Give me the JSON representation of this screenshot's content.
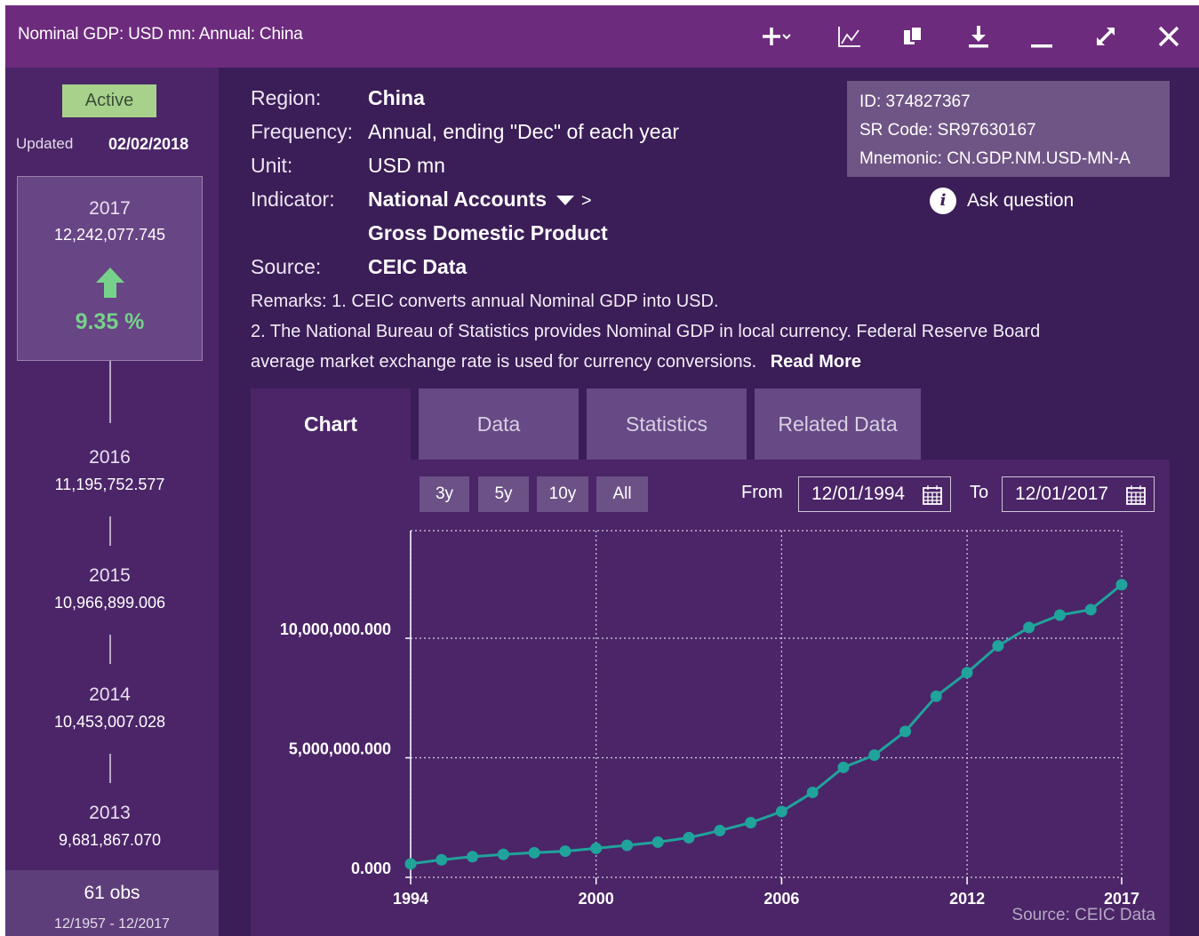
{
  "window": {
    "title": "Nominal GDP: USD mn: Annual: China",
    "toolbar_icons": [
      "add-dropdown-icon",
      "line-chart-icon",
      "copy-icon",
      "download-icon",
      "minimize-icon",
      "expand-icon",
      "close-icon"
    ]
  },
  "sidebar": {
    "status": "Active",
    "updated_label": "Updated",
    "updated_date": "02/02/2018",
    "current": {
      "year": "2017",
      "value": "12,242,077.745",
      "change": "9.35 %",
      "change_color": "#76d28a"
    },
    "history": [
      {
        "year": "2016",
        "value": "11,195,752.577"
      },
      {
        "year": "2015",
        "value": "10,966,899.006"
      },
      {
        "year": "2014",
        "value": "10,453,007.028"
      },
      {
        "year": "2013",
        "value": "9,681,867.070"
      }
    ],
    "obs_count": "61 obs",
    "obs_range": "12/1957 - 12/2017"
  },
  "meta": {
    "region_label": "Region:",
    "region": "China",
    "frequency_label": "Frequency:",
    "frequency": "Annual, ending \"Dec\" of each year",
    "unit_label": "Unit:",
    "unit": "USD mn",
    "indicator_label": "Indicator:",
    "indicator": "National Accounts",
    "indicator_sep": ">",
    "indicator_sub": "Gross Domestic Product",
    "source_label": "Source:",
    "source": "CEIC Data",
    "remarks_1": "Remarks: 1. CEIC converts annual Nominal GDP into USD.",
    "remarks_2": "2. The National Bureau of Statistics provides Nominal GDP in local currency. Federal Reserve Board",
    "remarks_3": "average market exchange rate is used for currency conversions.",
    "read_more": "Read More"
  },
  "idbox": {
    "id": "ID: 374827367",
    "sr_code": "SR Code: SR97630167",
    "mnemonic": "Mnemonic: CN.GDP.NM.USD-MN-A"
  },
  "ask_question": "Ask question",
  "tabs": [
    "Chart",
    "Data",
    "Statistics",
    "Related Data"
  ],
  "chart_controls": {
    "ranges": [
      "3y",
      "5y",
      "10y",
      "All"
    ],
    "from_label": "From",
    "from_date": "12/01/1994",
    "to_label": "To",
    "to_date": "12/01/2017"
  },
  "chart_data": {
    "type": "line",
    "x": [
      1994,
      1995,
      1996,
      1997,
      1998,
      1999,
      2000,
      2001,
      2002,
      2003,
      2004,
      2005,
      2006,
      2007,
      2008,
      2009,
      2010,
      2011,
      2012,
      2013,
      2014,
      2015,
      2016,
      2017
    ],
    "y": [
      564000,
      734000,
      863000,
      961000,
      1029000,
      1094000,
      1211000,
      1339000,
      1471000,
      1660000,
      1955000,
      2286000,
      2752000,
      3552000,
      4598000,
      5110000,
      6101000,
      7573000,
      8561000,
      9681867.07,
      10453007.028,
      10966899.006,
      11195752.577,
      12242077.745
    ],
    "xticks": [
      "1994",
      "2000",
      "2006",
      "2012",
      "2017"
    ],
    "yticks": [
      "0.000",
      "5,000,000.000",
      "10,000,000.000"
    ],
    "ylim": [
      0,
      14500000
    ],
    "xlim": [
      1994,
      2017
    ],
    "grid": true,
    "line_color": "#1fa39b",
    "source": "Source: CEIC Data"
  }
}
